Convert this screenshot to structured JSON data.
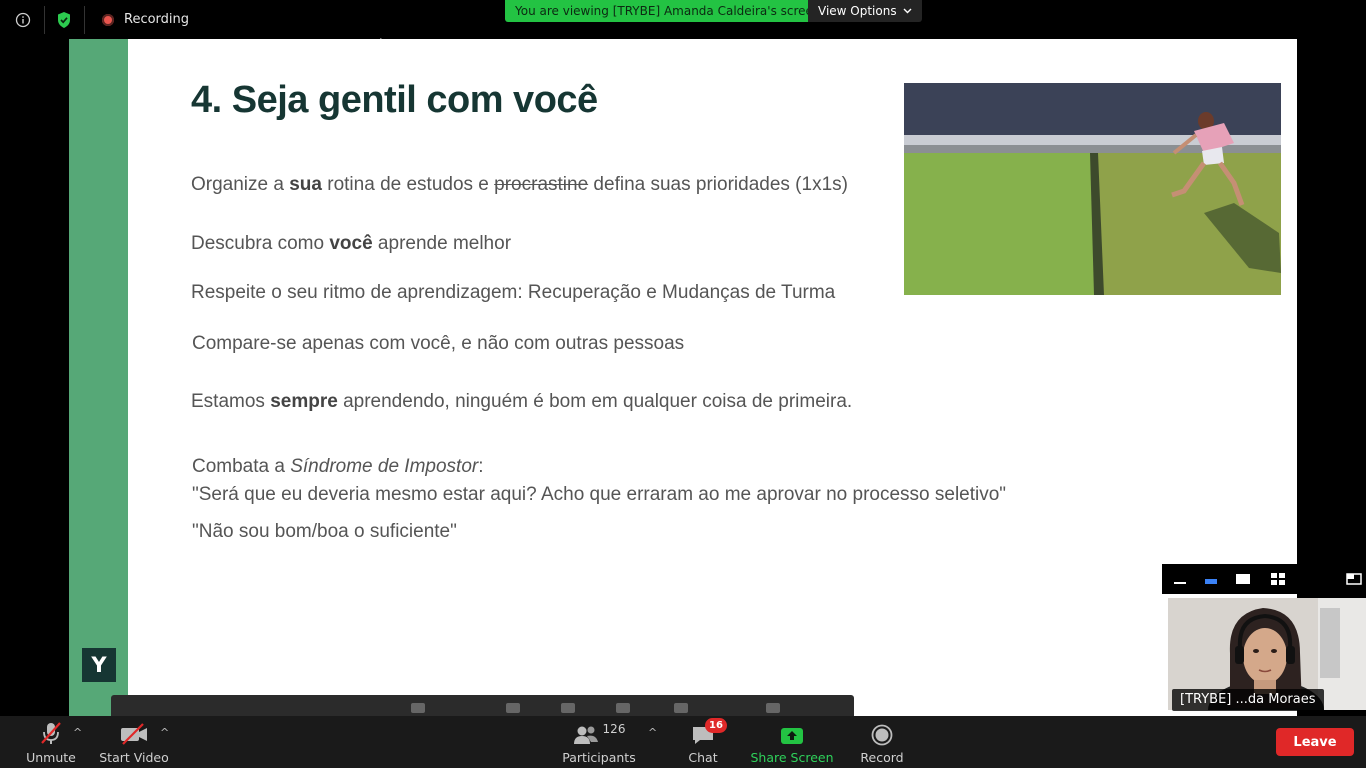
{
  "topbar": {
    "recording_label": "Recording",
    "viewing_banner": "You are viewing [TRYBE] Amanda Caldeira's screen",
    "view_options_label": "View Options"
  },
  "slide": {
    "title": "4. Seja gentil com você",
    "line1": {
      "a": "Organize a ",
      "b": "sua",
      "c": " rotina de estudos e ",
      "strike": "procrastine",
      "d": " defina suas prioridades (1x1s)"
    },
    "line2": {
      "a": "Descubra como ",
      "b": "você",
      "c": " aprende melhor"
    },
    "line3": "Respeite o seu ritmo de aprendizagem: Recuperação e Mudanças de Turma",
    "line4": "Compare-se apenas com você, e não com outras pessoas",
    "line5": {
      "a": "Estamos ",
      "b": "sempre",
      "c": " aprendendo, ninguém é bom em qualquer coisa de primeira."
    },
    "line6": {
      "a": "Combata a ",
      "i": "Síndrome de Impostor",
      "c": ":"
    },
    "line7": "\"Será que eu deveria mesmo estar aqui? Acho que erraram ao me aprovar no processo seletivo\"",
    "line8": "\"Não sou bom/boa o suficiente\"",
    "logo_letter": "Y"
  },
  "self_video": {
    "name": "[TRYBE] ...da Moraes"
  },
  "toolbar": {
    "unmute": "Unmute",
    "start_video": "Start Video",
    "participants": "Participants",
    "participants_count": "126",
    "chat": "Chat",
    "chat_badge": "16",
    "share_screen": "Share Screen",
    "record": "Record",
    "leave": "Leave"
  },
  "colors": {
    "accent_green": "#56a877",
    "banner_green": "#23c343",
    "leave_red": "#e02828",
    "title_dark": "#163633"
  }
}
